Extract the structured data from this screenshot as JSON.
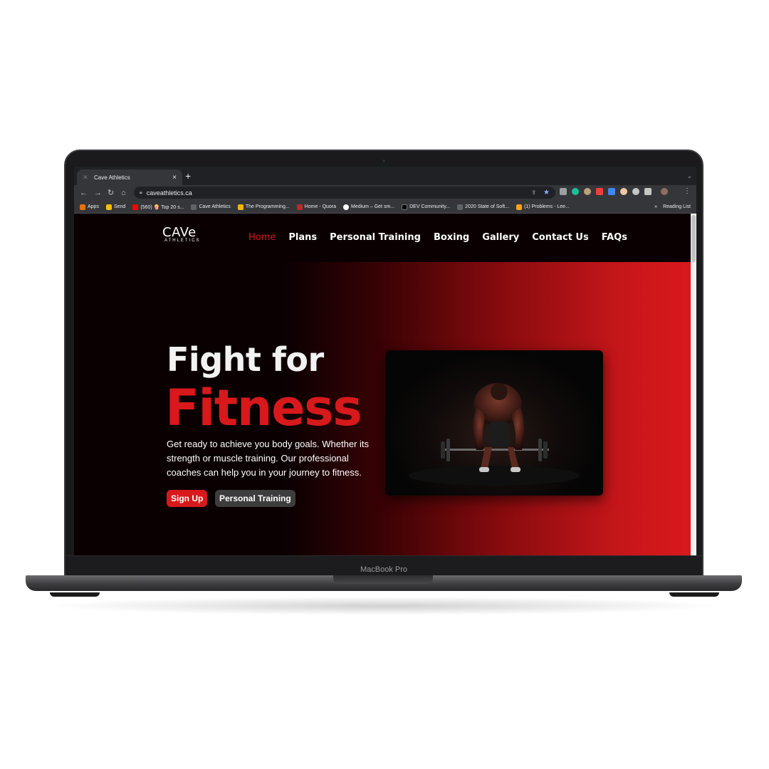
{
  "browser": {
    "tab_title": "Cave Athletics",
    "tab_close": "×",
    "new_tab": "+",
    "url": "caveathletics.ca",
    "bookmarks": [
      {
        "label": "Apps",
        "color": "#e8710a"
      },
      {
        "label": "Send",
        "color": "#fbbc04"
      },
      {
        "label": "(560) 🍿 Top 20 s...",
        "color": "#ff0000"
      },
      {
        "label": "Cave Athletics",
        "color": "#5f6368"
      },
      {
        "label": "The Programming...",
        "color": "#f4b400"
      },
      {
        "label": "Home - Quora",
        "color": "#b92b27"
      },
      {
        "label": "Medium – Get sm...",
        "color": "#ffffff"
      },
      {
        "label": "DEV Community...",
        "color": "#000000"
      },
      {
        "label": "2020 State of Soft...",
        "color": "#5f6368"
      },
      {
        "label": "(1) Problems - Lee...",
        "color": "#ffa116"
      }
    ],
    "more_bookmarks": "»",
    "reading_list": "Reading List"
  },
  "site": {
    "logo": {
      "main": "CAVe",
      "sub": "ATHLETICS"
    },
    "nav": [
      "Home",
      "Plans",
      "Personal Training",
      "Boxing",
      "Gallery",
      "Contact Us",
      "FAQs"
    ],
    "hero": {
      "title_line1": "Fight for",
      "title_line2": "Fitness",
      "description": "Get ready to achieve you body goals. Whether its strength or muscle training. Our professional coaches can help you in your journey to fitness.",
      "signup_button": "Sign Up",
      "pt_button": "Personal Training"
    }
  },
  "device": {
    "model": "MacBook Pro"
  },
  "colors": {
    "accent": "#d7191c",
    "background": "#0a0002"
  }
}
